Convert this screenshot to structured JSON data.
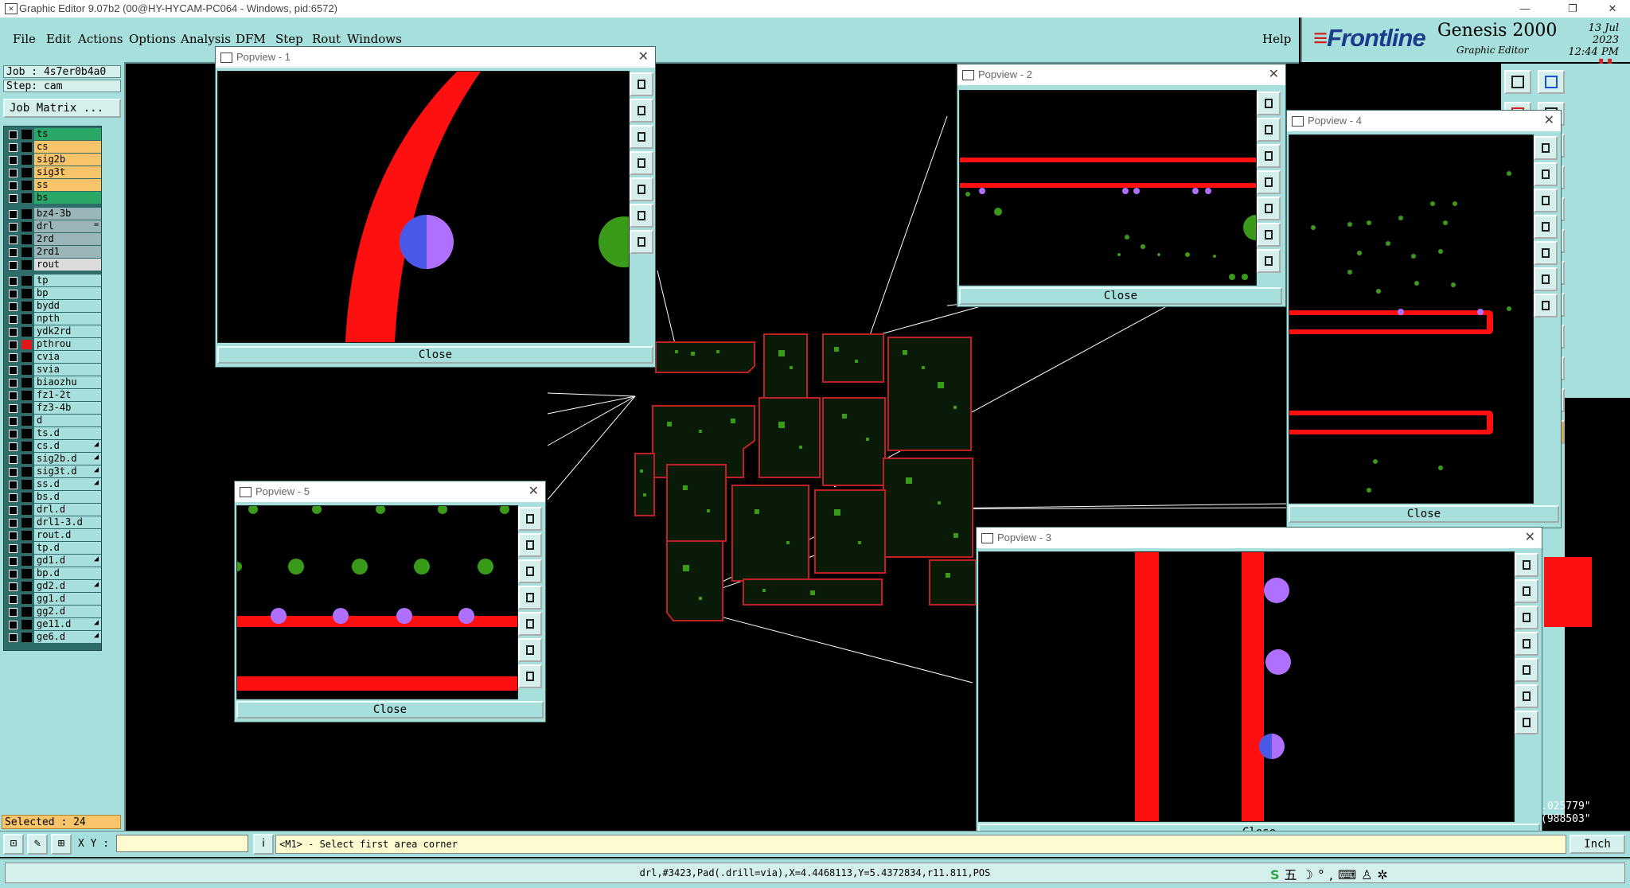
{
  "window": {
    "title": "Graphic Editor 9.07b2 (00@HY-HYCAM-PC064 - Windows, pid:6572)",
    "minimize": "—",
    "restore": "❐",
    "close": "✕"
  },
  "menu": {
    "items": [
      "File",
      "Edit",
      "Actions",
      "Options",
      "Analysis",
      "DFM",
      "Step",
      "Rout",
      "Windows"
    ],
    "help": "Help"
  },
  "brand": {
    "logo": "Frontline",
    "product": "Genesis 2000",
    "subtitle": "Graphic Editor",
    "date": "13 Jul 2023",
    "time": "12:44 PM"
  },
  "job": {
    "job_line": "Job : 4s7er0b4a0",
    "step_line": "Step: cam",
    "matrix_button": "Job Matrix ..."
  },
  "layers": [
    {
      "name": "ts",
      "color": "#2aa868",
      "swatch": "#000000",
      "mark": ""
    },
    {
      "name": "cs",
      "color": "#f7c46a",
      "swatch": "#000000",
      "mark": ""
    },
    {
      "name": "sig2b",
      "color": "#f7c46a",
      "swatch": "#000000",
      "mark": ""
    },
    {
      "name": "sig3t",
      "color": "#f7c46a",
      "swatch": "#000000",
      "mark": ""
    },
    {
      "name": "ss",
      "color": "#f7c46a",
      "swatch": "#000000",
      "mark": ""
    },
    {
      "name": "bs",
      "color": "#2aa868",
      "swatch": "#000000",
      "mark": ""
    },
    {
      "name": "bz4-3b",
      "color": "#9ab5b8",
      "swatch": "#000000",
      "mark": ""
    },
    {
      "name": "drl",
      "color": "#9ab5b8",
      "swatch": "#000000",
      "mark": "="
    },
    {
      "name": "2rd",
      "color": "#9ab5b8",
      "swatch": "#000000",
      "mark": ""
    },
    {
      "name": "2rd1",
      "color": "#9ab5b8",
      "swatch": "#000000",
      "mark": ""
    },
    {
      "name": "rout",
      "color": "#dcdcdc",
      "swatch": "#000000",
      "mark": ""
    },
    {
      "name": "tp",
      "color": "#a7dfdc",
      "swatch": "#000000",
      "mark": ""
    },
    {
      "name": "bp",
      "color": "#a7dfdc",
      "swatch": "#000000",
      "mark": ""
    },
    {
      "name": "bydd",
      "color": "#a7dfdc",
      "swatch": "#000000",
      "mark": ""
    },
    {
      "name": "npth",
      "color": "#a7dfdc",
      "swatch": "#000000",
      "mark": ""
    },
    {
      "name": "ydk2rd",
      "color": "#a7dfdc",
      "swatch": "#000000",
      "mark": ""
    },
    {
      "name": "pthrou",
      "color": "#a7dfdc",
      "swatch": "#e01818",
      "mark": ""
    },
    {
      "name": "cvia",
      "color": "#a7dfdc",
      "swatch": "#000000",
      "mark": ""
    },
    {
      "name": "svia",
      "color": "#a7dfdc",
      "swatch": "#000000",
      "mark": ""
    },
    {
      "name": "biaozhu",
      "color": "#a7dfdc",
      "swatch": "#000000",
      "mark": ""
    },
    {
      "name": "fz1-2t",
      "color": "#a7dfdc",
      "swatch": "#000000",
      "mark": ""
    },
    {
      "name": "fz3-4b",
      "color": "#a7dfdc",
      "swatch": "#000000",
      "mark": ""
    },
    {
      "name": "d",
      "color": "#a7dfdc",
      "swatch": "#000000",
      "mark": ""
    },
    {
      "name": "ts.d",
      "color": "#a7dfdc",
      "swatch": "#000000",
      "mark": ""
    },
    {
      "name": "cs.d",
      "color": "#a7dfdc",
      "swatch": "#000000",
      "mark": "◢"
    },
    {
      "name": "sig2b.d",
      "color": "#a7dfdc",
      "swatch": "#000000",
      "mark": "◢"
    },
    {
      "name": "sig3t.d",
      "color": "#a7dfdc",
      "swatch": "#000000",
      "mark": "◢"
    },
    {
      "name": "ss.d",
      "color": "#a7dfdc",
      "swatch": "#000000",
      "mark": "◢"
    },
    {
      "name": "bs.d",
      "color": "#a7dfdc",
      "swatch": "#000000",
      "mark": ""
    },
    {
      "name": "drl.d",
      "color": "#a7dfdc",
      "swatch": "#000000",
      "mark": ""
    },
    {
      "name": "drl1-3.d",
      "color": "#a7dfdc",
      "swatch": "#000000",
      "mark": ""
    },
    {
      "name": "rout.d",
      "color": "#a7dfdc",
      "swatch": "#000000",
      "mark": ""
    },
    {
      "name": "tp.d",
      "color": "#a7dfdc",
      "swatch": "#000000",
      "mark": ""
    },
    {
      "name": "gd1.d",
      "color": "#a7dfdc",
      "swatch": "#000000",
      "mark": "◢"
    },
    {
      "name": "bp.d",
      "color": "#a7dfdc",
      "swatch": "#000000",
      "mark": ""
    },
    {
      "name": "gd2.d",
      "color": "#a7dfdc",
      "swatch": "#000000",
      "mark": "◢"
    },
    {
      "name": "gg1.d",
      "color": "#a7dfdc",
      "swatch": "#000000",
      "mark": ""
    },
    {
      "name": "gg2.d",
      "color": "#a7dfdc",
      "swatch": "#000000",
      "mark": ""
    },
    {
      "name": "ge11.d",
      "color": "#a7dfdc",
      "swatch": "#000000",
      "mark": "◢"
    },
    {
      "name": "ge6.d",
      "color": "#a7dfdc",
      "swatch": "#000000",
      "mark": "◢"
    }
  ],
  "selected_text": "Selected : 24",
  "coordinates": {
    "line1": ".025779\"",
    "line2": "(988503\""
  },
  "statusbar": {
    "xy_label": "X Y :",
    "xy_value": "",
    "prompt": "<M1> - Select first area corner",
    "units_button": "Inch",
    "info": "drl,#3423,Pad(.drill=via),X=4.4468113,Y=5.4372834,r11.811,POS"
  },
  "popviews": [
    {
      "title": "Popview - 1",
      "close": "Close"
    },
    {
      "title": "Popview - 2",
      "close": "Close"
    },
    {
      "title": "Popview - 3",
      "close": "Close"
    },
    {
      "title": "Popview - 4",
      "close": "Close"
    },
    {
      "title": "Popview - 5",
      "close": "Close"
    }
  ],
  "tray_icons": [
    "ime-icon",
    "five-stroke-icon",
    "moon-icon",
    "punctuation-icon",
    "keyboard-icon",
    "user-icon",
    "settings-icon"
  ],
  "colors": {
    "panel": "#a7dfdc",
    "trace": "#ff1010",
    "pad": "#3a9a1a",
    "via": "#b070ff",
    "selected": "#f7c46a"
  }
}
